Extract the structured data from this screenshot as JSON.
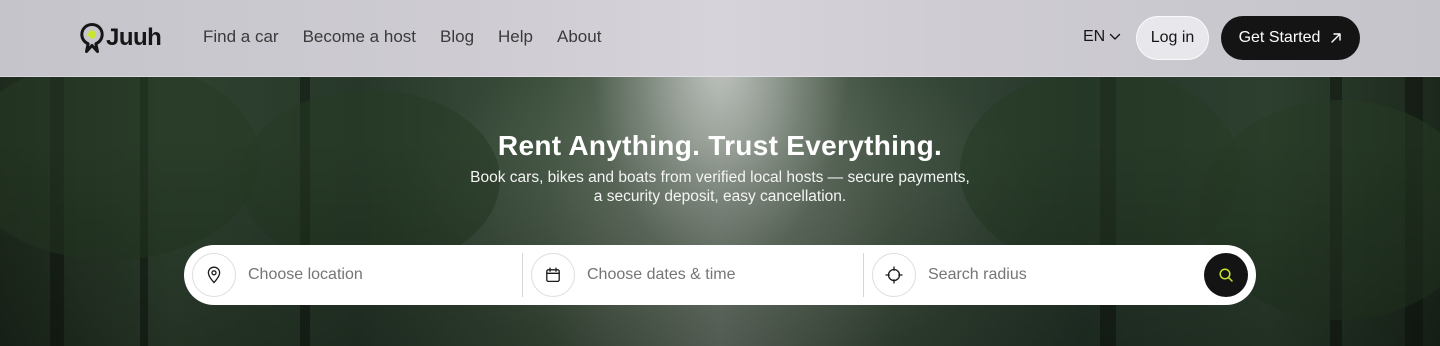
{
  "brand": {
    "name": "Juuh",
    "accent": "#c9e62f"
  },
  "nav": {
    "items": [
      {
        "label": "Find a car"
      },
      {
        "label": "Become a host"
      },
      {
        "label": "Blog"
      },
      {
        "label": "Help"
      },
      {
        "label": "About"
      }
    ]
  },
  "header": {
    "language": "EN",
    "login_label": "Log in",
    "cta_label": "Get Started"
  },
  "hero": {
    "title": "Rent Anything. Trust Everything.",
    "subtitle_line1": "Book cars, bikes and boats from verified local hosts — secure payments,",
    "subtitle_line2": "a security deposit, easy cancellation."
  },
  "search": {
    "location_placeholder": "Choose location",
    "dates_placeholder": "Choose dates & time",
    "radius_placeholder": "Search radius",
    "icons": [
      "map-pin-icon",
      "calendar-icon",
      "crosshair-icon",
      "search-icon"
    ]
  },
  "colors": {
    "dark": "#141414",
    "white": "#ffffff",
    "header_bg": "#cfcdd3"
  }
}
